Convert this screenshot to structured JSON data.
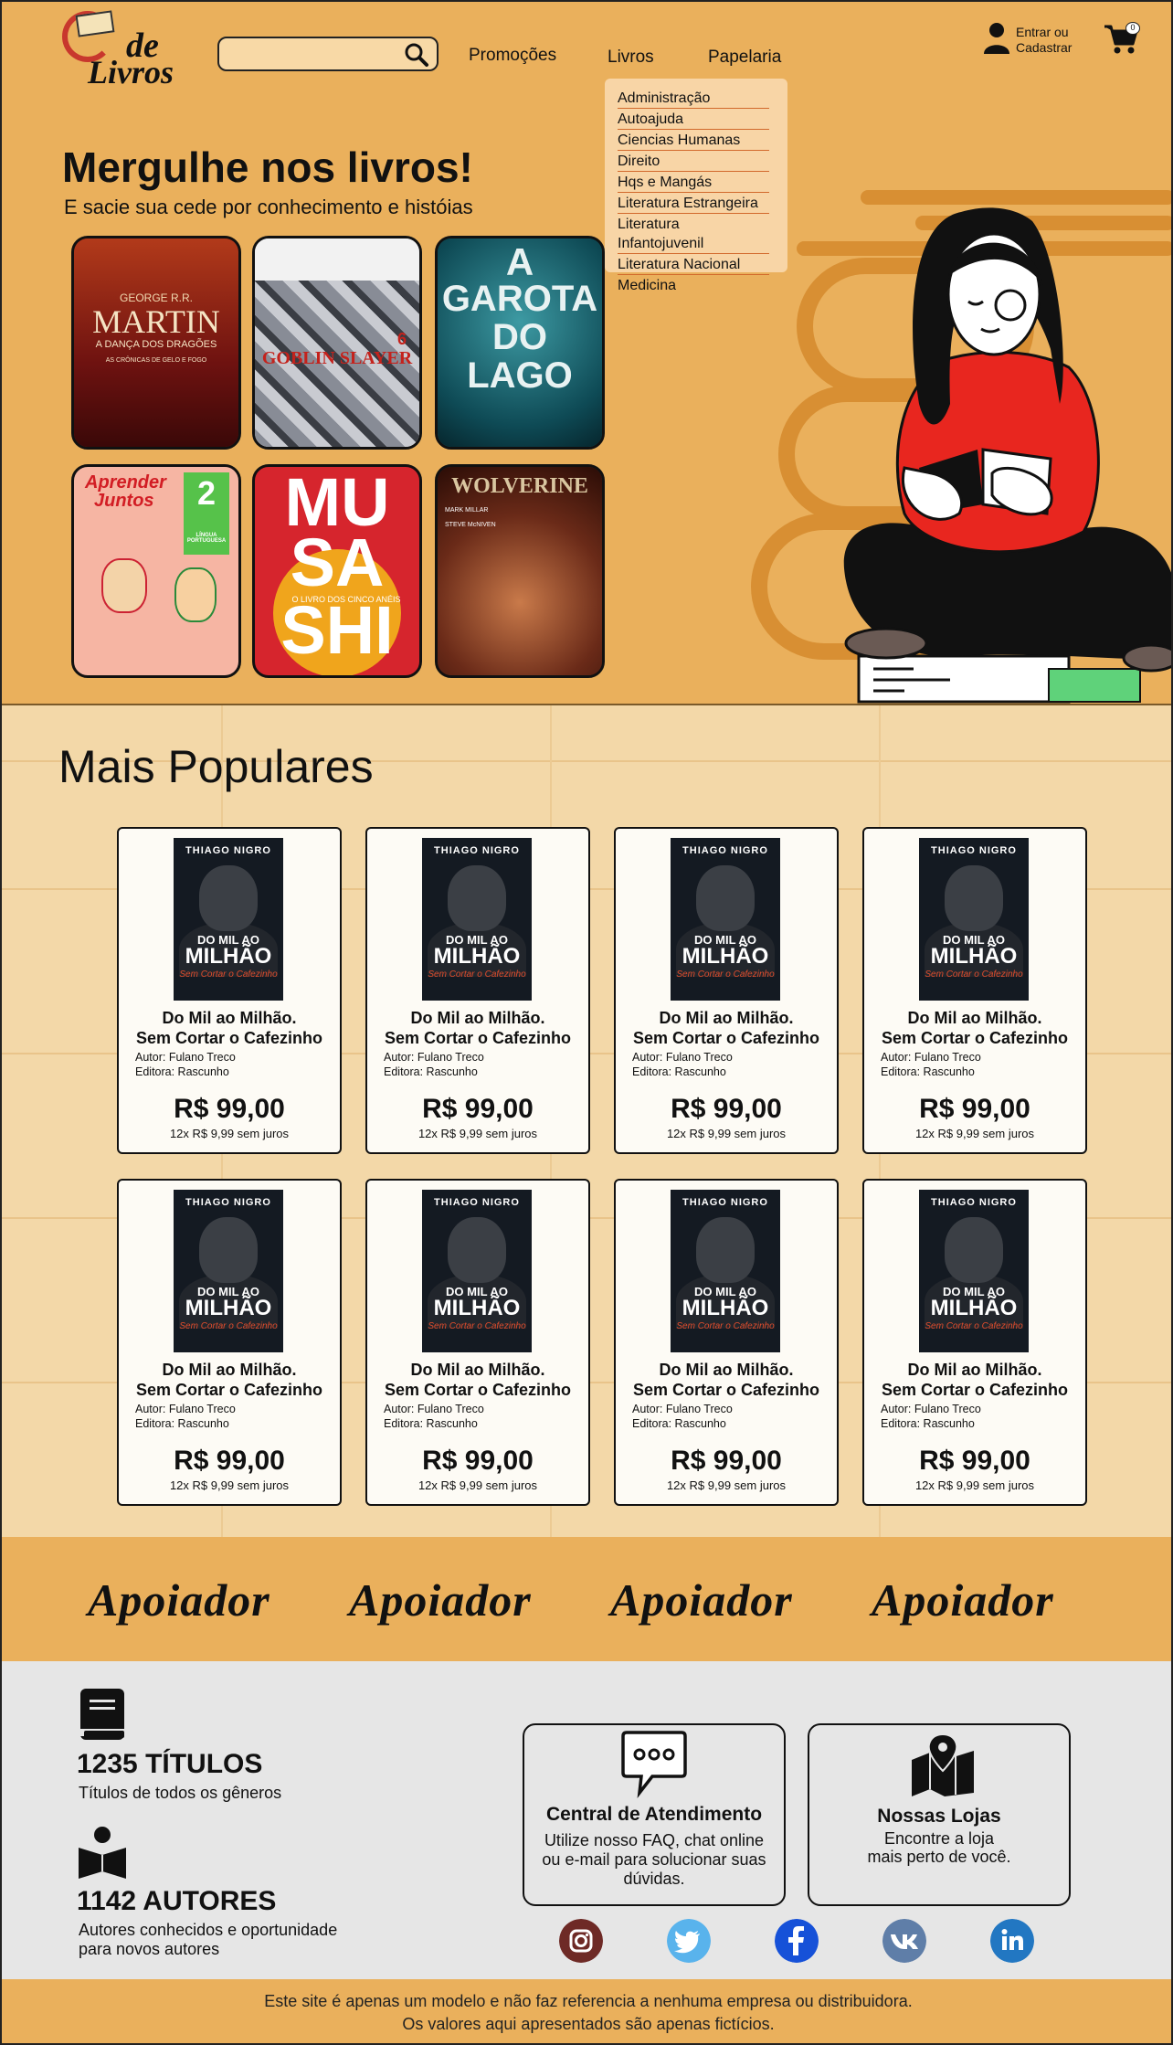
{
  "header": {
    "logo_text_top": "de",
    "logo_text_bottom": "Livros",
    "search": {
      "placeholder": ""
    },
    "nav": [
      "Promoções",
      "Livros",
      "Papelaria"
    ],
    "account_line1": "Entrar ou",
    "account_line2": "Cadastrar",
    "cart_count": "0"
  },
  "dropdown": {
    "items": [
      "Administração",
      "Autoajuda",
      "Ciencias Humanas",
      "Direito",
      "Hqs e Mangás",
      "Literatura Estrangeira",
      "Literatura Infantojuvenil",
      "Literatura Nacional",
      "Medicina"
    ]
  },
  "hero": {
    "title": "Mergulhe nos livros!",
    "subtitle": "E sacie sua cede por conhecimento e históias",
    "covers": [
      {
        "line1": "GEORGE R.R.",
        "line2": "MARTIN",
        "line3": "A DANÇA DOS DRAGÕES",
        "line4": "AS CRÔNICAS DE GELO E FOGO",
        "color": "#7a1a16"
      },
      {
        "line1": "",
        "line2": "GOBLIN SLAYER",
        "line3": "6",
        "line4": "",
        "color": "#6b6f7c"
      },
      {
        "line1": "A",
        "line2": "GAROTA",
        "line3": "DO",
        "line4": "LAGO",
        "color": "#0e5a66"
      },
      {
        "line1": "Aprender",
        "line2": "Juntos",
        "line3": "2",
        "line4": "LÍNGUA PORTUGUESA",
        "color": "#f6b5a3"
      },
      {
        "line1": "MU",
        "line2": "SA",
        "line3": "SHI",
        "line4": "O LIVRO DOS CINCO ANÉIS",
        "color": "#d6252d"
      },
      {
        "line1": "WOLVERINE",
        "line2": "MARK MILLAR",
        "line3": "STEVE McNIVEN",
        "line4": "",
        "color": "#5a2418"
      }
    ]
  },
  "popular": {
    "title": "Mais Populares",
    "cards": [
      {
        "cover_author": "THIAGO NIGRO",
        "cover_t1": "DO MIL AO",
        "cover_t2": "MILHÃO",
        "cover_t3": "Sem Cortar o Cafezinho",
        "title1": "Do Mil ao Milhão.",
        "title2": "Sem Cortar o Cafezinho",
        "author": "Autor: Fulano Treco",
        "publisher": "Editora: Rascunho",
        "price": "R$ 99,00",
        "installments": "12x R$ 9,99 sem juros"
      },
      {
        "cover_author": "THIAGO NIGRO",
        "cover_t1": "DO MIL AO",
        "cover_t2": "MILHÃO",
        "cover_t3": "Sem Cortar o Cafezinho",
        "title1": "Do Mil ao Milhão.",
        "title2": "Sem Cortar o Cafezinho",
        "author": "Autor: Fulano Treco",
        "publisher": "Editora: Rascunho",
        "price": "R$ 99,00",
        "installments": "12x R$ 9,99 sem juros"
      },
      {
        "cover_author": "THIAGO NIGRO",
        "cover_t1": "DO MIL AO",
        "cover_t2": "MILHÃO",
        "cover_t3": "Sem Cortar o Cafezinho",
        "title1": "Do Mil ao Milhão.",
        "title2": "Sem Cortar o Cafezinho",
        "author": "Autor: Fulano Treco",
        "publisher": "Editora: Rascunho",
        "price": "R$ 99,00",
        "installments": "12x R$ 9,99 sem juros"
      },
      {
        "cover_author": "THIAGO NIGRO",
        "cover_t1": "DO MIL AO",
        "cover_t2": "MILHÃO",
        "cover_t3": "Sem Cortar o Cafezinho",
        "title1": "Do Mil ao Milhão.",
        "title2": "Sem Cortar o Cafezinho",
        "author": "Autor: Fulano Treco",
        "publisher": "Editora: Rascunho",
        "price": "R$ 99,00",
        "installments": "12x R$ 9,99 sem juros"
      },
      {
        "cover_author": "THIAGO NIGRO",
        "cover_t1": "DO MIL AO",
        "cover_t2": "MILHÃO",
        "cover_t3": "Sem Cortar o Cafezinho",
        "title1": "Do Mil ao Milhão.",
        "title2": "Sem Cortar o Cafezinho",
        "author": "Autor: Fulano Treco",
        "publisher": "Editora: Rascunho",
        "price": "R$ 99,00",
        "installments": "12x R$ 9,99 sem juros"
      },
      {
        "cover_author": "THIAGO NIGRO",
        "cover_t1": "DO MIL AO",
        "cover_t2": "MILHÃO",
        "cover_t3": "Sem Cortar o Cafezinho",
        "title1": "Do Mil ao Milhão.",
        "title2": "Sem Cortar o Cafezinho",
        "author": "Autor: Fulano Treco",
        "publisher": "Editora: Rascunho",
        "price": "R$ 99,00",
        "installments": "12x R$ 9,99 sem juros"
      },
      {
        "cover_author": "THIAGO NIGRO",
        "cover_t1": "DO MIL AO",
        "cover_t2": "MILHÃO",
        "cover_t3": "Sem Cortar o Cafezinho",
        "title1": "Do Mil ao Milhão.",
        "title2": "Sem Cortar o Cafezinho",
        "author": "Autor: Fulano Treco",
        "publisher": "Editora: Rascunho",
        "price": "R$ 99,00",
        "installments": "12x R$ 9,99 sem juros"
      },
      {
        "cover_author": "THIAGO NIGRO",
        "cover_t1": "DO MIL AO",
        "cover_t2": "MILHÃO",
        "cover_t3": "Sem Cortar o Cafezinho",
        "title1": "Do Mil ao Milhão.",
        "title2": "Sem Cortar o Cafezinho",
        "author": "Autor: Fulano Treco",
        "publisher": "Editora: Rascunho",
        "price": "R$ 99,00",
        "installments": "12x R$ 9,99 sem juros"
      }
    ]
  },
  "sponsors": [
    "Apoiador",
    "Apoiador",
    "Apoiador",
    "Apoiador"
  ],
  "stats": {
    "titles_count": "1235 TÍTULOS",
    "titles_desc": "Títulos de todos os gêneros",
    "authors_count": "1142 AUTORES",
    "authors_desc_1": "Autores conhecidos e oportunidade",
    "authors_desc_2": "para novos autores"
  },
  "support": {
    "title": "Central de Atendimento",
    "line1": "Utilize nosso FAQ, chat online",
    "line2": "ou e-mail para solucionar suas",
    "line3": "dúvidas."
  },
  "stores": {
    "title": "Nossas Lojas",
    "line1": "Encontre a loja",
    "line2": "mais perto de você."
  },
  "social": [
    {
      "name": "instagram-icon",
      "color": "#6e2a26"
    },
    {
      "name": "twitter-icon",
      "color": "#59b3ec"
    },
    {
      "name": "facebook-icon",
      "color": "#1651d8"
    },
    {
      "name": "vk-icon",
      "color": "#5f7ea8"
    },
    {
      "name": "linkedin-icon",
      "color": "#2277c2"
    }
  ],
  "disclaimer": {
    "line1": "Este site é apenas um modelo e não faz referencia a nenhuma empresa ou distribuidora.",
    "line2": "Os valores aqui apresentados são apenas fictícios."
  },
  "colors": {
    "accent": "#eab05c",
    "popular_bg": "#f3d8a8",
    "footer_bg": "#e6e6e6",
    "shirt": "#e8261f"
  }
}
